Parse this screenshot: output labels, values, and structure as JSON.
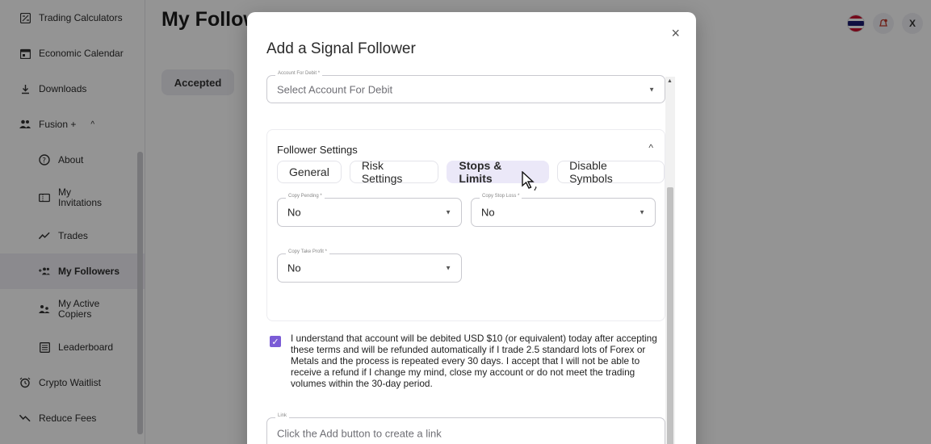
{
  "sidebar": {
    "items": [
      {
        "label": "Trading Calculators",
        "icon": "calculator-icon"
      },
      {
        "label": "Economic Calendar",
        "icon": "calendar-icon"
      },
      {
        "label": "Downloads",
        "icon": "download-icon"
      },
      {
        "label": "Fusion +",
        "icon": "people-icon",
        "expanded": true
      },
      {
        "label": "About",
        "icon": "help-icon",
        "sub": true
      },
      {
        "label": "My Invitations",
        "icon": "ticket-icon",
        "sub": true
      },
      {
        "label": "Trades",
        "icon": "trend-icon",
        "sub": true
      },
      {
        "label": "My Followers",
        "icon": "followers-icon",
        "sub": true,
        "active": true
      },
      {
        "label": "My Active Copiers",
        "icon": "copiers-icon",
        "sub": true
      },
      {
        "label": "Leaderboard",
        "icon": "leaderboard-icon",
        "sub": true
      },
      {
        "label": "Crypto Waitlist",
        "icon": "alarm-icon"
      },
      {
        "label": "Reduce Fees",
        "icon": "trend-down-icon"
      }
    ]
  },
  "page": {
    "title": "My Follow",
    "tab_accepted": "Accepted"
  },
  "topbar": {
    "language_icon": "flag-icon",
    "notification_icon": "bell-icon",
    "user_initial": "X"
  },
  "modal": {
    "title": "Add a Signal Follower",
    "close": "×",
    "account_field": {
      "label": "Account For Debit *",
      "placeholder": "Select Account For Debit"
    },
    "settings": {
      "title": "Follower Settings",
      "tabs": [
        "General",
        "Risk Settings",
        "Stops & Limits",
        "Disable Symbols"
      ],
      "active_tab": "Stops & Limits",
      "copy_pending": {
        "label": "Copy Pending *",
        "value": "No"
      },
      "copy_stop_loss": {
        "label": "Copy Stop Loss *",
        "value": "No"
      },
      "copy_take_profit": {
        "label": "Copy Take Profit *",
        "value": "No"
      }
    },
    "terms_checked": true,
    "terms_text": "I understand that account will be debited USD $10 (or equivalent) today after accepting these terms and will be refunded automatically if I trade 2.5 standard lots of Forex or Metals and the process is repeated every 30 days. I accept that I will not be able to receive a refund if I change my mind, close my account or do not meet the trading volumes within the 30-day period.",
    "link_field": {
      "label": "Link",
      "placeholder": "Click the Add button to create a link"
    }
  },
  "colors": {
    "accent": "#7b5cd6",
    "active_tab_bg": "#ebe8f8"
  }
}
